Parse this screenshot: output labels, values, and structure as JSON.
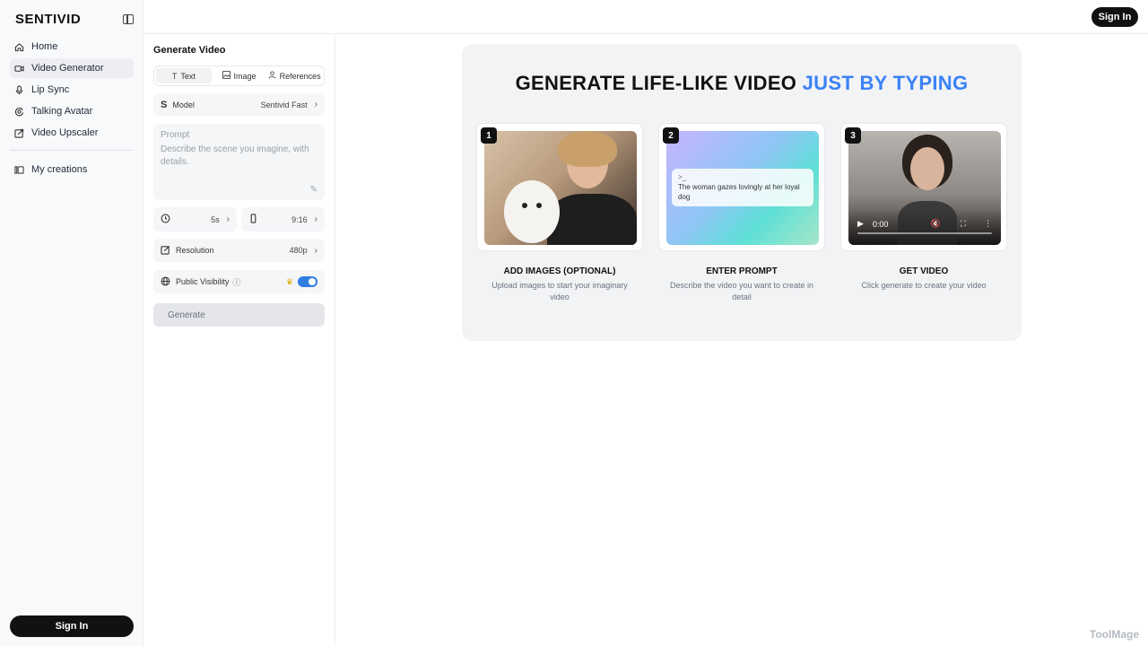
{
  "app": {
    "logo": "SENTIVID"
  },
  "sidebar": {
    "items": [
      {
        "label": "Home",
        "icon": "home-icon"
      },
      {
        "label": "Video Generator",
        "icon": "video-icon"
      },
      {
        "label": "Lip Sync",
        "icon": "mic-icon"
      },
      {
        "label": "Talking Avatar",
        "icon": "avatar-icon"
      },
      {
        "label": "Video Upscaler",
        "icon": "upscale-icon"
      }
    ],
    "creations_label": "My creations",
    "signin_label": "Sign In"
  },
  "topbar": {
    "signin_label": "Sign In"
  },
  "panel": {
    "title": "Generate Video",
    "tabs": [
      {
        "label": "Text",
        "icon": "text-icon"
      },
      {
        "label": "Image",
        "icon": "image-icon"
      },
      {
        "label": "References",
        "icon": "references-icon"
      }
    ],
    "model": {
      "label": "Model",
      "value": "Sentivid Fast"
    },
    "prompt": {
      "label": "Prompt",
      "placeholder": "Describe the scene you imagine, with details."
    },
    "duration": "5s",
    "aspect_ratio": "9:16",
    "resolution": {
      "label": "Resolution",
      "value": "480p"
    },
    "visibility": {
      "label": "Public Visibility",
      "enabled": true
    },
    "generate_label": "Generate"
  },
  "hero": {
    "title_main": "GENERATE LIFE-LIKE VIDEO",
    "title_accent": "JUST BY TYPING",
    "accent_color": "#3b82f6",
    "steps": [
      {
        "num": "1",
        "heading": "ADD IMAGES (OPTIONAL)",
        "desc": "Upload images to start your imaginary video"
      },
      {
        "num": "2",
        "heading": "ENTER PROMPT",
        "desc": "Describe the video you want to create in detail",
        "sample_prefix": ">_",
        "sample_prompt": "The woman gazes lovingly at her loyal dog"
      },
      {
        "num": "3",
        "heading": "GET VIDEO",
        "desc": "Click generate to create your video",
        "video_time": "0:00"
      }
    ]
  },
  "watermark": "ToolMage"
}
